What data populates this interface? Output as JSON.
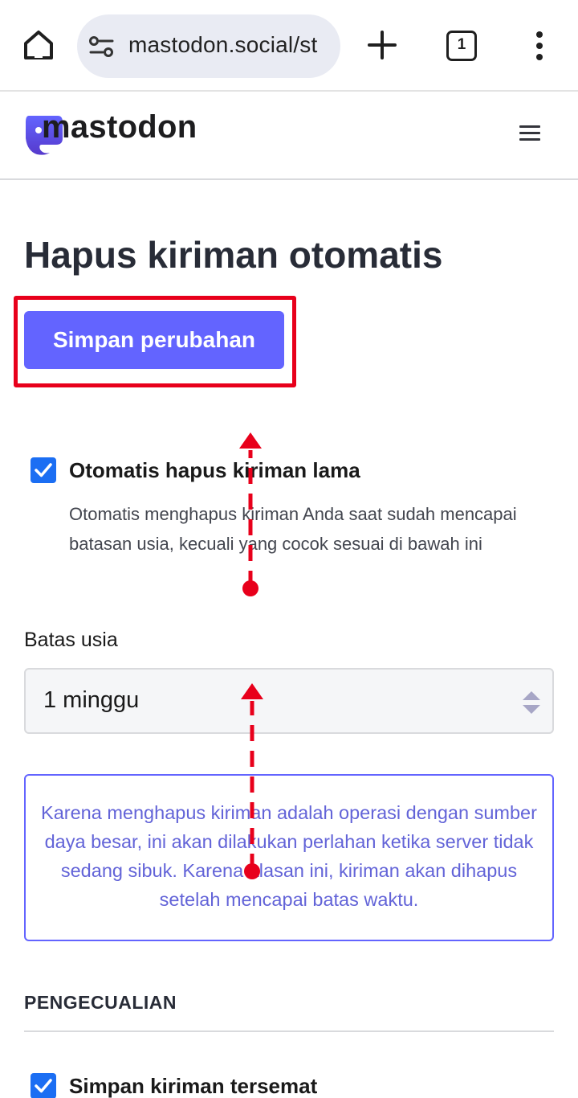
{
  "browser": {
    "url": "mastodon.social/st",
    "tab_count": "1",
    "icons": [
      "home-icon",
      "site-settings-icon",
      "plus-icon",
      "tabs-icon",
      "more-vert-icon"
    ]
  },
  "site": {
    "logo_text": "mastodon",
    "menu_icon": "hamburger-icon"
  },
  "page": {
    "title": "Hapus kiriman otomatis",
    "save_label": "Simpan perubahan",
    "auto_delete": {
      "label": "Otomatis hapus kiriman lama",
      "checked": true,
      "hint": "Otomatis menghapus kiriman Anda saat sudah mencapai batasan usia, kecuali yang cocok sesuai di bawah ini"
    },
    "age_limit": {
      "label": "Batas usia",
      "value": "1 minggu"
    },
    "info": "Karena menghapus kiriman adalah operasi dengan sumber daya besar, ini akan dilakukan perlahan ketika server tidak sedang sibuk. Karena alasan ini, kiriman akan dihapus setelah mencapai batas waktu.",
    "exceptions": {
      "title": "PENGECUALIAN",
      "keep_pinned": {
        "label": "Simpan kiriman tersemat",
        "checked": true
      }
    }
  },
  "colors": {
    "accent": "#6364ff",
    "checkbox": "#1b6ef3",
    "highlight": "#e8001b"
  }
}
